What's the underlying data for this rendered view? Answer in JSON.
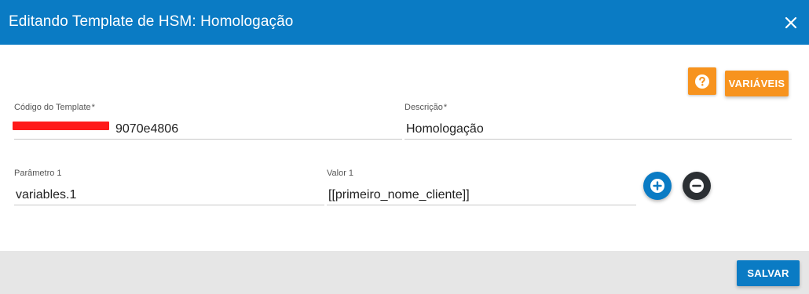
{
  "dialog": {
    "title": "Editando Template de HSM: Homologação",
    "close_icon": "close-icon"
  },
  "toolbar": {
    "help_icon": "help-circle-icon",
    "variables_label": "VARIÁVEIS"
  },
  "form": {
    "template_code": {
      "label": "Código do Template",
      "required_mark": "*",
      "value": "9070e4806"
    },
    "description": {
      "label": "Descrição",
      "required_mark": "*",
      "value": "Homologação"
    },
    "parameters": [
      {
        "param_label": "Parâmetro 1",
        "param_value": "variables.1",
        "value_label": "Valor 1",
        "value_value": "[[primeiro_nome_cliente]]"
      }
    ],
    "add_icon": "plus-circle-icon",
    "remove_icon": "minus-circle-icon"
  },
  "footer": {
    "save_label": "SALVAR"
  },
  "colors": {
    "primary": "#0a7bc4",
    "accent": "#f7931e",
    "dark": "#2b2f33",
    "footer_bg": "#e6e6e6"
  }
}
